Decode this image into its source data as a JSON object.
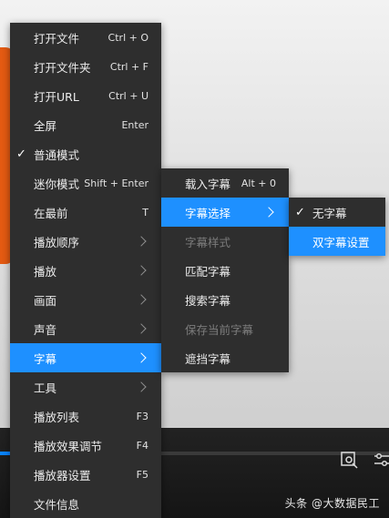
{
  "main_menu": {
    "items": [
      {
        "label": "打开文件",
        "shortcut": "Ctrl + O"
      },
      {
        "label": "打开文件夹",
        "shortcut": "Ctrl + F"
      },
      {
        "label": "打开URL",
        "shortcut": "Ctrl + U"
      },
      {
        "label": "全屏",
        "shortcut": "Enter"
      },
      {
        "label": "普通模式",
        "shortcut": "",
        "checked": true
      },
      {
        "label": "迷你模式",
        "shortcut": "Shift + Enter"
      },
      {
        "label": "在最前",
        "shortcut": "T"
      },
      {
        "label": "播放顺序",
        "shortcut": "",
        "submenu": true
      },
      {
        "label": "播放",
        "shortcut": "",
        "submenu": true
      },
      {
        "label": "画面",
        "shortcut": "",
        "submenu": true
      },
      {
        "label": "声音",
        "shortcut": "",
        "submenu": true
      },
      {
        "label": "字幕",
        "shortcut": "",
        "submenu": true,
        "active": true
      },
      {
        "label": "工具",
        "shortcut": "",
        "submenu": true
      },
      {
        "label": "播放列表",
        "shortcut": "F3"
      },
      {
        "label": "播放效果调节",
        "shortcut": "F4"
      },
      {
        "label": "播放器设置",
        "shortcut": "F5"
      },
      {
        "label": "文件信息",
        "shortcut": ""
      }
    ],
    "check_mark": "✓"
  },
  "subtitle_menu": {
    "items": [
      {
        "label": "载入字幕",
        "shortcut": "Alt + 0"
      },
      {
        "label": "字幕选择",
        "submenu": true,
        "active": true
      },
      {
        "label": "字幕样式",
        "disabled": true
      },
      {
        "label": "匹配字幕"
      },
      {
        "label": "搜索字幕"
      },
      {
        "label": "保存当前字幕",
        "disabled": true
      },
      {
        "label": "遮挡字幕"
      }
    ]
  },
  "subtitle_select_menu": {
    "items": [
      {
        "label": "无字幕",
        "checked": true
      },
      {
        "label": "双字幕设置",
        "active": true
      }
    ],
    "check_mark": "✓"
  },
  "watermark": "头条 @大数据民工",
  "progress": {
    "fraction": 0.03
  },
  "colors": {
    "accent": "#1e90ff",
    "menu_bg": "#2e2e2e",
    "orange": "#e45a12"
  },
  "icons": {
    "control_left": "screenshot-icon",
    "control_right": "settings-sliders-icon"
  }
}
